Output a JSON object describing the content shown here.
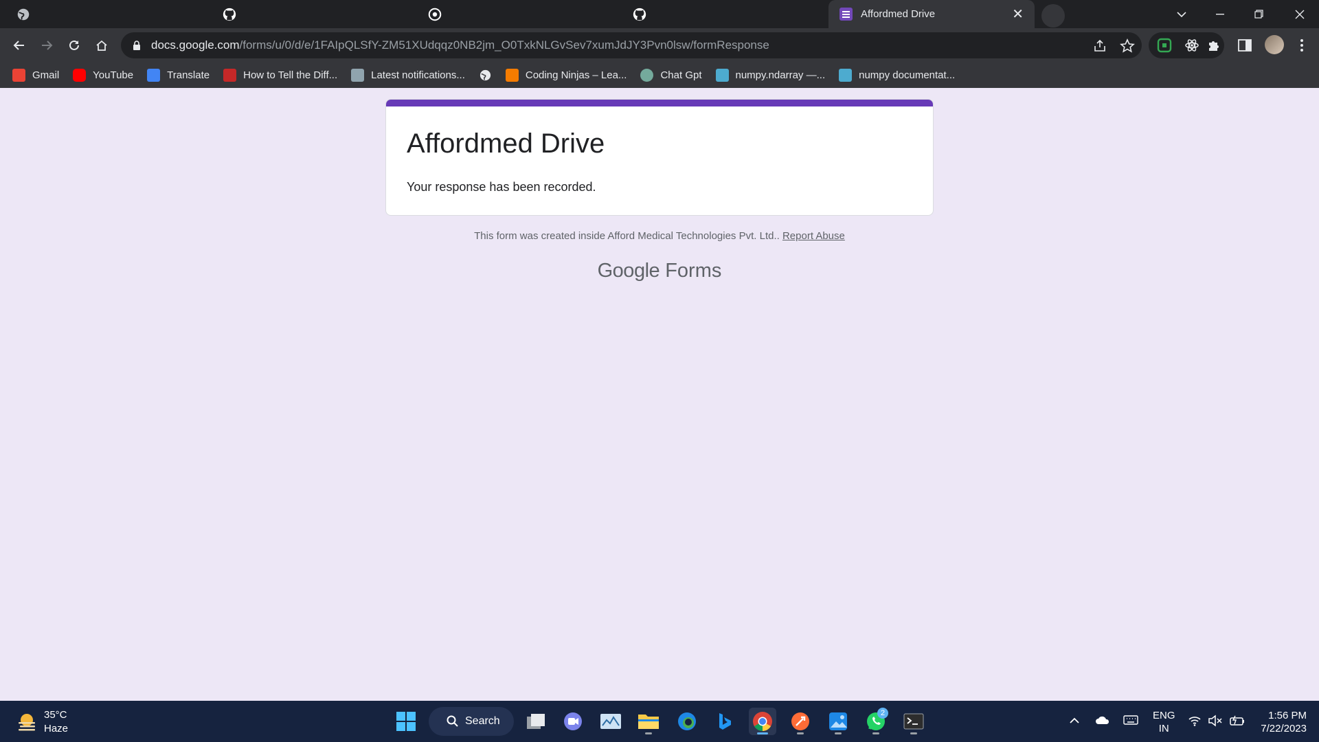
{
  "browser": {
    "active_tab_title": "Affordmed Drive",
    "url_host": "docs.google.com",
    "url_path": "/forms/u/0/d/e/1FAIpQLSfY-ZM51XUdqqz0NB2jm_O0TxkNLGvSev7xumJdJY3Pvn0lsw/formResponse",
    "bookmarks": [
      {
        "label": "Gmail",
        "color": "#ea4335"
      },
      {
        "label": "YouTube",
        "color": "#ff0000"
      },
      {
        "label": "Translate",
        "color": "#4285f4"
      },
      {
        "label": "How to Tell the Diff...",
        "color": "#c62828"
      },
      {
        "label": "Latest notifications...",
        "color": "#90a4ae"
      },
      {
        "label": "",
        "color": "#e8eaed"
      },
      {
        "label": "Coding Ninjas – Lea...",
        "color": "#f57c00"
      },
      {
        "label": "Chat Gpt",
        "color": "#74aa9c"
      },
      {
        "label": "numpy.ndarray —...",
        "color": "#4dabcf"
      },
      {
        "label": "numpy documentat...",
        "color": "#4dabcf"
      }
    ]
  },
  "form": {
    "title": "Affordmed Drive",
    "message": "Your response has been recorded.",
    "footer_text": "This form was created inside Afford Medical Technologies Pvt. Ltd..",
    "report_link": "Report Abuse",
    "logo_google": "Google",
    "logo_forms": "Forms",
    "accent_color": "#673ab7"
  },
  "taskbar": {
    "weather_temp": "35°C",
    "weather_condition": "Haze",
    "search_label": "Search",
    "lang_line1": "ENG",
    "lang_line2": "IN",
    "time": "1:56 PM",
    "date": "7/22/2023",
    "whatsapp_badge": "2"
  }
}
